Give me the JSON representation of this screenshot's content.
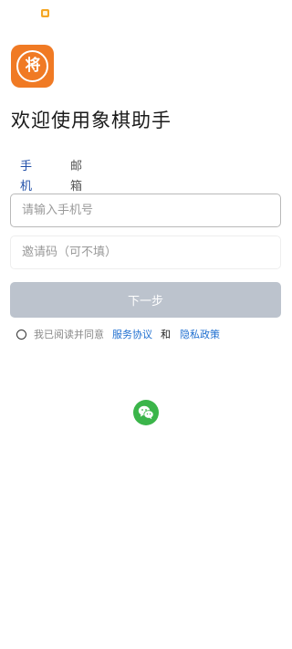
{
  "title": "欢迎使用象棋助手",
  "app_logo_text": "将",
  "tabs": [
    "手机号",
    "邮箱"
  ],
  "active_tab": "手机号",
  "phone_input": {
    "placeholder": "请输入手机号",
    "value": ""
  },
  "invite_input": {
    "placeholder": "邀请码（可不填）",
    "value": ""
  },
  "next_button": "下一步",
  "agreement": {
    "prefix": "我已阅读并同意",
    "service_link": "服务协议",
    "and": "和",
    "privacy_link": "隐私政策",
    "checked": false
  },
  "colors": {
    "accent": "#2d6fd6",
    "link": "#1f6fd0",
    "button_disabled": "#bcc3cd",
    "logo": "#f07a24",
    "wechat": "#3bb54a"
  },
  "icons": [
    "notification-icon",
    "app-logo",
    "wechat-icon"
  ]
}
